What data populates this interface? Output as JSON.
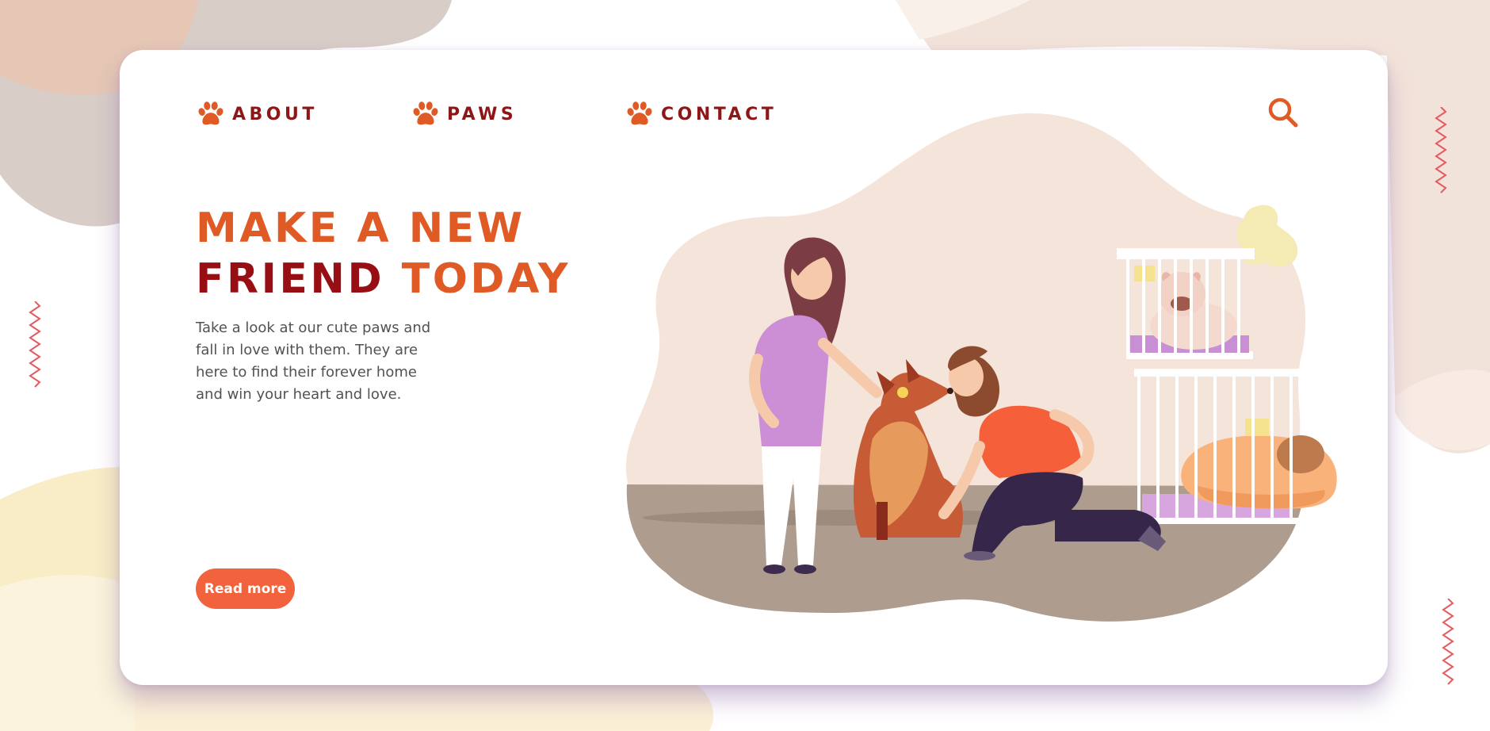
{
  "nav": {
    "items": [
      {
        "label": "ABOUT"
      },
      {
        "label": "PAWS"
      },
      {
        "label": "CONTACT"
      }
    ]
  },
  "hero": {
    "headline_line1": "MAKE A NEW",
    "headline_line2_part1": "FRIEND",
    "headline_line2_part2": "TODAY",
    "description": "Take a look at our cute paws and fall in love with them. They are here to find their forever home and win your heart and love.",
    "cta_label": "Read more"
  },
  "icons": {
    "nav": "paw-icon",
    "search": "search-icon"
  },
  "colors": {
    "accent_orange": "#e05a25",
    "accent_red": "#970f15",
    "button": "#f2623d",
    "body_text": "#525252"
  }
}
